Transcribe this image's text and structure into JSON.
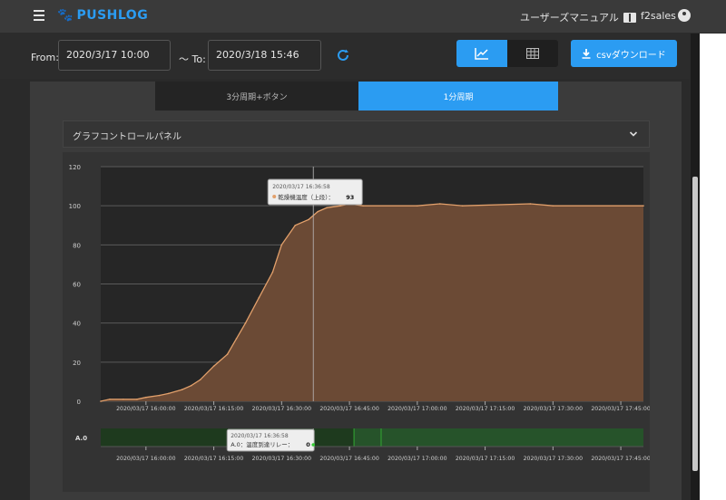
{
  "header": {
    "brand": "PUSHLOG",
    "manual_label": "ユーザーズマニュアル",
    "user_name": "f2sales"
  },
  "toolbar": {
    "from_label": "From:",
    "from_value": "2020/3/17 10:00",
    "to_label": "～ To:",
    "to_value": "2020/3/18 15:46",
    "csv_label": "csvダウンロード"
  },
  "tabs": [
    {
      "label": "3分周期+ボタン",
      "active": false
    },
    {
      "label": "1分周期",
      "active": true
    }
  ],
  "control_panel": {
    "title": "グラフコントロールパネル"
  },
  "chart_data": {
    "type": "area",
    "color": "#e2a06b",
    "fill": "#6b4a35",
    "ylim": [
      0,
      120
    ],
    "y_ticks": [
      "120",
      "100",
      "80",
      "60",
      "40",
      "20",
      "0"
    ],
    "x_tick_labels": [
      "2020/03/17 16:00:00",
      "2020/03/17 16:15:00",
      "2020/03/17 16:30:00",
      "2020/03/17 16:45:00",
      "2020/03/17 17:00:00",
      "2020/03/17 17:15:00",
      "2020/03/17 17:30:00",
      "2020/03/17 17:45:00"
    ],
    "x_minutes_start": "15:50",
    "x_minutes_end": "17:50",
    "points": [
      [
        "15:50",
        0
      ],
      [
        "15:52",
        1
      ],
      [
        "15:55",
        1
      ],
      [
        "15:58",
        1
      ],
      [
        "16:00",
        2
      ],
      [
        "16:03",
        3
      ],
      [
        "16:05",
        4
      ],
      [
        "16:08",
        6
      ],
      [
        "16:10",
        8
      ],
      [
        "16:12",
        11
      ],
      [
        "16:15",
        18
      ],
      [
        "16:18",
        24
      ],
      [
        "16:20",
        32
      ],
      [
        "16:22",
        40
      ],
      [
        "16:25",
        53
      ],
      [
        "16:28",
        66
      ],
      [
        "16:30",
        80
      ],
      [
        "16:33",
        90
      ],
      [
        "16:36",
        93
      ],
      [
        "16:38",
        97
      ],
      [
        "16:40",
        99
      ],
      [
        "16:43",
        100
      ],
      [
        "16:45",
        101
      ],
      [
        "16:48",
        100
      ],
      [
        "17:00",
        100
      ],
      [
        "17:05",
        101
      ],
      [
        "17:10",
        100
      ],
      [
        "17:25",
        101
      ],
      [
        "17:30",
        100
      ],
      [
        "17:50",
        100
      ]
    ],
    "tooltip": {
      "time": "2020/03/17 16:36:58",
      "series": "乾燥機温度（上段）",
      "value": "93"
    }
  },
  "relay_chart": {
    "row_label": "A.0",
    "x_tick_labels": [
      "2020/03/17 16:00:00",
      "2020/03/17 16:15:00",
      "2020/03/17 16:30:00",
      "2020/03/17 16:45:00",
      "2020/03/17 17:00:00",
      "2020/03/17 17:15:00",
      "2020/03/17 17:30:00",
      "2020/03/17 17:45:00"
    ],
    "tooltip": {
      "time": "2020/03/17 16:36:58",
      "series": "A.0：温度到達リレー",
      "value": "0"
    }
  }
}
